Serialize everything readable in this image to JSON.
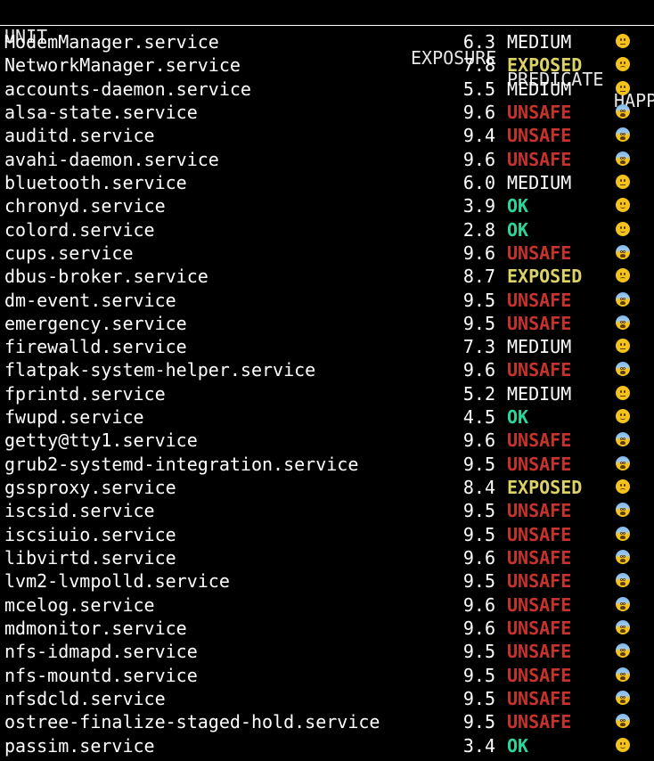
{
  "header": {
    "unit": "UNIT",
    "exposure": "EXPOSURE",
    "predicate": "PREDICATE",
    "happy": "HAPP"
  },
  "colors": {
    "UNSAFE": "#c8322c",
    "EXPOSED": "#dcd266",
    "OK": "#2ed49a",
    "MEDIUM": "#ffffff"
  },
  "rows": [
    {
      "unit": "ModemManager.service",
      "exposure": "6.3",
      "predicate": "MEDIUM",
      "happy_icon": "neutral-face-icon"
    },
    {
      "unit": "NetworkManager.service",
      "exposure": "7.8",
      "predicate": "EXPOSED",
      "happy_icon": "slightly-frowning-face-icon"
    },
    {
      "unit": "accounts-daemon.service",
      "exposure": "5.5",
      "predicate": "MEDIUM",
      "happy_icon": "neutral-face-icon"
    },
    {
      "unit": "alsa-state.service",
      "exposure": "9.6",
      "predicate": "UNSAFE",
      "happy_icon": "fearful-face-icon"
    },
    {
      "unit": "auditd.service",
      "exposure": "9.4",
      "predicate": "UNSAFE",
      "happy_icon": "fearful-face-icon"
    },
    {
      "unit": "avahi-daemon.service",
      "exposure": "9.6",
      "predicate": "UNSAFE",
      "happy_icon": "fearful-face-icon"
    },
    {
      "unit": "bluetooth.service",
      "exposure": "6.0",
      "predicate": "MEDIUM",
      "happy_icon": "neutral-face-icon"
    },
    {
      "unit": "chronyd.service",
      "exposure": "3.9",
      "predicate": "OK",
      "happy_icon": "slightly-smiling-face-icon"
    },
    {
      "unit": "colord.service",
      "exposure": "2.8",
      "predicate": "OK",
      "happy_icon": "slightly-smiling-face-icon"
    },
    {
      "unit": "cups.service",
      "exposure": "9.6",
      "predicate": "UNSAFE",
      "happy_icon": "fearful-face-icon"
    },
    {
      "unit": "dbus-broker.service",
      "exposure": "8.7",
      "predicate": "EXPOSED",
      "happy_icon": "slightly-frowning-face-icon"
    },
    {
      "unit": "dm-event.service",
      "exposure": "9.5",
      "predicate": "UNSAFE",
      "happy_icon": "fearful-face-icon"
    },
    {
      "unit": "emergency.service",
      "exposure": "9.5",
      "predicate": "UNSAFE",
      "happy_icon": "fearful-face-icon"
    },
    {
      "unit": "firewalld.service",
      "exposure": "7.3",
      "predicate": "MEDIUM",
      "happy_icon": "neutral-face-icon"
    },
    {
      "unit": "flatpak-system-helper.service",
      "exposure": "9.6",
      "predicate": "UNSAFE",
      "happy_icon": "fearful-face-icon"
    },
    {
      "unit": "fprintd.service",
      "exposure": "5.2",
      "predicate": "MEDIUM",
      "happy_icon": "neutral-face-icon"
    },
    {
      "unit": "fwupd.service",
      "exposure": "4.5",
      "predicate": "OK",
      "happy_icon": "slightly-smiling-face-icon"
    },
    {
      "unit": "getty@tty1.service",
      "exposure": "9.6",
      "predicate": "UNSAFE",
      "happy_icon": "fearful-face-icon"
    },
    {
      "unit": "grub2-systemd-integration.service",
      "exposure": "9.5",
      "predicate": "UNSAFE",
      "happy_icon": "fearful-face-icon"
    },
    {
      "unit": "gssproxy.service",
      "exposure": "8.4",
      "predicate": "EXPOSED",
      "happy_icon": "slightly-frowning-face-icon"
    },
    {
      "unit": "iscsid.service",
      "exposure": "9.5",
      "predicate": "UNSAFE",
      "happy_icon": "fearful-face-icon"
    },
    {
      "unit": "iscsiuio.service",
      "exposure": "9.5",
      "predicate": "UNSAFE",
      "happy_icon": "fearful-face-icon"
    },
    {
      "unit": "libvirtd.service",
      "exposure": "9.6",
      "predicate": "UNSAFE",
      "happy_icon": "fearful-face-icon"
    },
    {
      "unit": "lvm2-lvmpolld.service",
      "exposure": "9.5",
      "predicate": "UNSAFE",
      "happy_icon": "fearful-face-icon"
    },
    {
      "unit": "mcelog.service",
      "exposure": "9.6",
      "predicate": "UNSAFE",
      "happy_icon": "fearful-face-icon"
    },
    {
      "unit": "mdmonitor.service",
      "exposure": "9.6",
      "predicate": "UNSAFE",
      "happy_icon": "fearful-face-icon"
    },
    {
      "unit": "nfs-idmapd.service",
      "exposure": "9.5",
      "predicate": "UNSAFE",
      "happy_icon": "fearful-face-icon"
    },
    {
      "unit": "nfs-mountd.service",
      "exposure": "9.5",
      "predicate": "UNSAFE",
      "happy_icon": "fearful-face-icon"
    },
    {
      "unit": "nfsdcld.service",
      "exposure": "9.5",
      "predicate": "UNSAFE",
      "happy_icon": "fearful-face-icon"
    },
    {
      "unit": "ostree-finalize-staged-hold.service",
      "exposure": "9.5",
      "predicate": "UNSAFE",
      "happy_icon": "fearful-face-icon"
    },
    {
      "unit": "passim.service",
      "exposure": "3.4",
      "predicate": "OK",
      "happy_icon": "slightly-smiling-face-icon"
    }
  ]
}
